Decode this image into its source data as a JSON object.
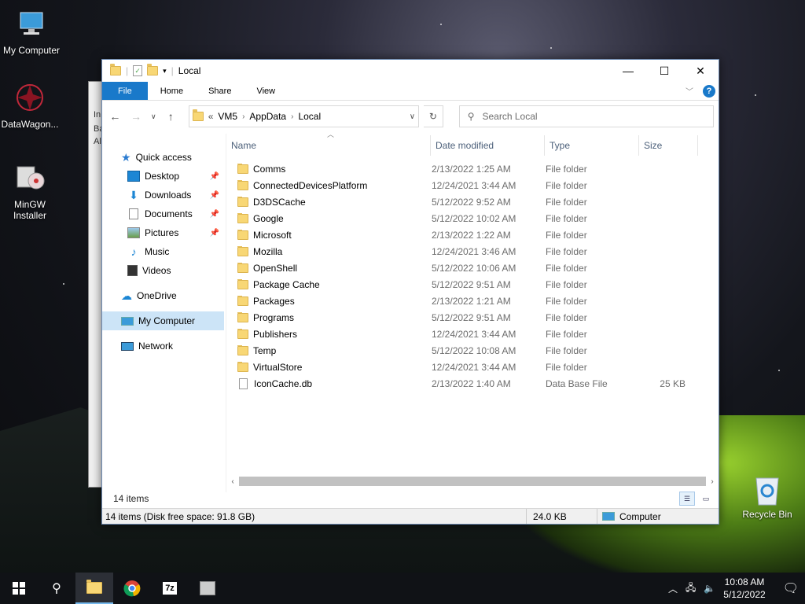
{
  "desktop": {
    "icons": [
      {
        "label": "My Computer",
        "icon": "monitor-icon"
      },
      {
        "label": "DataWagon...",
        "icon": "datawagon-icon"
      },
      {
        "label": "MinGW\nInstaller",
        "icon": "installer-icon"
      }
    ],
    "recycle_bin": "Recycle Bin",
    "back_window_text": [
      "In",
      "Ba",
      "Al"
    ]
  },
  "window": {
    "title": "Local",
    "controls": {
      "minimize": "—",
      "maximize": "☐",
      "close": "✕"
    },
    "ribbon": {
      "file": "File",
      "home": "Home",
      "share": "Share",
      "view": "View",
      "help": "?"
    },
    "address": {
      "prefix": "«",
      "parts": [
        "VM5",
        "AppData",
        "Local"
      ]
    },
    "search_placeholder": "Search Local",
    "nav": {
      "quick_access": "Quick access",
      "pinned": [
        "Desktop",
        "Downloads",
        "Documents",
        "Pictures"
      ],
      "unpinned": [
        "Music",
        "Videos"
      ],
      "onedrive": "OneDrive",
      "my_computer": "My Computer",
      "network": "Network"
    },
    "columns": {
      "name": "Name",
      "date": "Date modified",
      "type": "Type",
      "size": "Size"
    },
    "files": [
      {
        "name": "Comms",
        "date": "2/13/2022 1:25 AM",
        "type": "File folder",
        "size": "",
        "kind": "folder"
      },
      {
        "name": "ConnectedDevicesPlatform",
        "date": "12/24/2021 3:44 AM",
        "type": "File folder",
        "size": "",
        "kind": "folder"
      },
      {
        "name": "D3DSCache",
        "date": "5/12/2022 9:52 AM",
        "type": "File folder",
        "size": "",
        "kind": "folder"
      },
      {
        "name": "Google",
        "date": "5/12/2022 10:02 AM",
        "type": "File folder",
        "size": "",
        "kind": "folder"
      },
      {
        "name": "Microsoft",
        "date": "2/13/2022 1:22 AM",
        "type": "File folder",
        "size": "",
        "kind": "folder"
      },
      {
        "name": "Mozilla",
        "date": "12/24/2021 3:46 AM",
        "type": "File folder",
        "size": "",
        "kind": "folder"
      },
      {
        "name": "OpenShell",
        "date": "5/12/2022 10:06 AM",
        "type": "File folder",
        "size": "",
        "kind": "folder"
      },
      {
        "name": "Package Cache",
        "date": "5/12/2022 9:51 AM",
        "type": "File folder",
        "size": "",
        "kind": "folder"
      },
      {
        "name": "Packages",
        "date": "2/13/2022 1:21 AM",
        "type": "File folder",
        "size": "",
        "kind": "folder"
      },
      {
        "name": "Programs",
        "date": "5/12/2022 9:51 AM",
        "type": "File folder",
        "size": "",
        "kind": "folder"
      },
      {
        "name": "Publishers",
        "date": "12/24/2021 3:44 AM",
        "type": "File folder",
        "size": "",
        "kind": "folder"
      },
      {
        "name": "Temp",
        "date": "5/12/2022 10:08 AM",
        "type": "File folder",
        "size": "",
        "kind": "folder"
      },
      {
        "name": "VirtualStore",
        "date": "12/24/2021 3:44 AM",
        "type": "File folder",
        "size": "",
        "kind": "folder"
      },
      {
        "name": "IconCache.db",
        "date": "2/13/2022 1:40 AM",
        "type": "Data Base File",
        "size": "25 KB",
        "kind": "file"
      }
    ],
    "item_count": "14 items",
    "statusbar": {
      "summary": "14 items (Disk free space: 91.8 GB)",
      "size": "24.0 KB",
      "location": "Computer"
    }
  },
  "taskbar": {
    "time": "10:08 AM",
    "date": "5/12/2022",
    "apps": [
      "file-explorer-icon",
      "chrome-icon",
      "7zip-icon",
      "installer-icon"
    ]
  },
  "colors": {
    "accent": "#1979ca",
    "selection": "#cce4f7",
    "folder": "#f8d775"
  }
}
